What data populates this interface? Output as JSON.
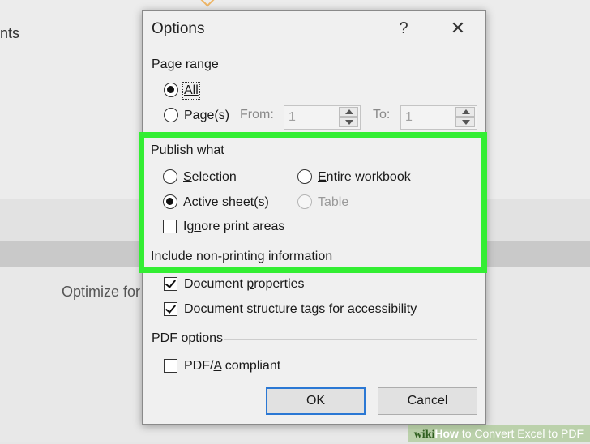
{
  "background": {
    "left_text": "nts",
    "optimize_text": "Optimize for"
  },
  "dialog": {
    "title": "Options",
    "help_label": "?",
    "close_label": "✕"
  },
  "page_range": {
    "group_label": "Page range",
    "all_label": "All",
    "pages_label": "Page(s)",
    "from_label": "From:",
    "from_value": "1",
    "to_label": "To:",
    "to_value": "1",
    "selected": "All"
  },
  "publish_what": {
    "group_label": "Publish what",
    "selection_label": "Selection",
    "entire_workbook_label": "Entire workbook",
    "active_sheets_label": "Active sheet(s)",
    "table_label": "Table",
    "ignore_print_areas_label": "Ignore print areas",
    "selected": "Active sheet(s)",
    "ignore_print_areas_checked": false
  },
  "non_printing": {
    "group_label": "Include non-printing information",
    "document_properties_label": "Document properties",
    "document_properties_checked": true,
    "structure_tags_label": "Document structure tags for accessibility",
    "structure_tags_checked": true
  },
  "pdf_options": {
    "group_label": "PDF options",
    "pdfa_label": "PDF/A compliant",
    "pdfa_checked": false
  },
  "buttons": {
    "ok_label": "OK",
    "cancel_label": "Cancel"
  },
  "watermark": {
    "wiki": "wiki",
    "how": "How",
    "rest": " to Convert Excel to PDF"
  },
  "colors": {
    "highlight": "#33ee33",
    "default_button_border": "#2b78d4"
  }
}
